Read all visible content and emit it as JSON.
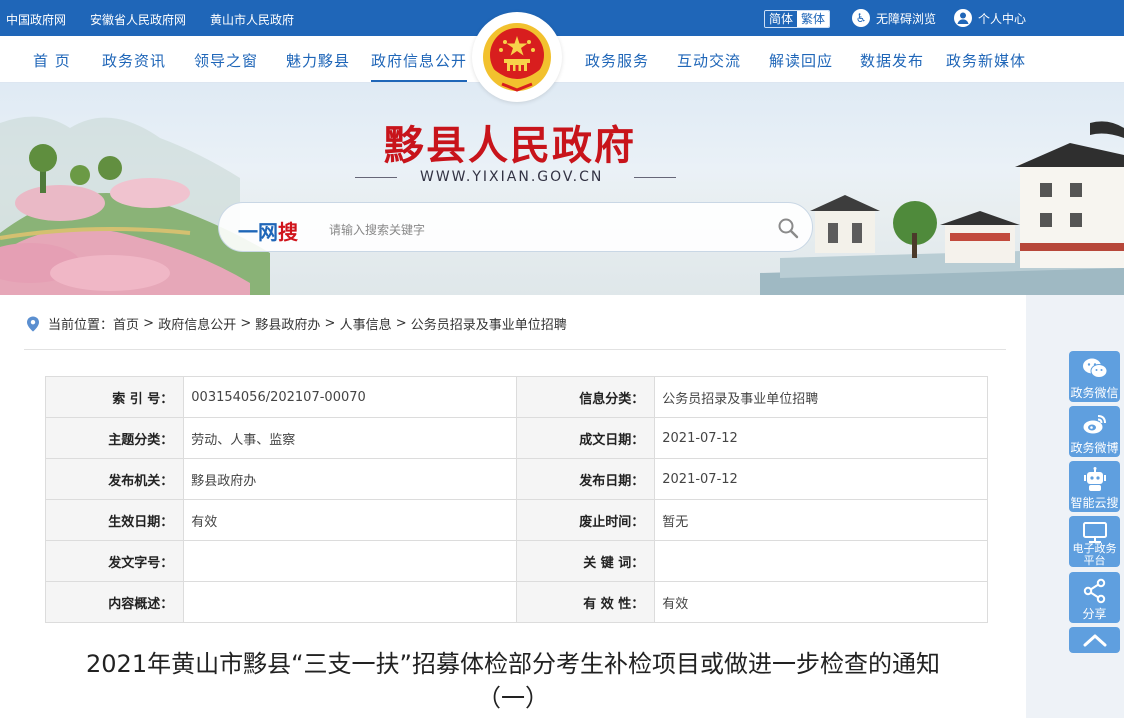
{
  "topbar": {
    "links": [
      "中国政府网",
      "安徽省人民政府网",
      "黄山市人民政府"
    ],
    "lang_simplified": "简体",
    "lang_traditional": "繁体",
    "accessibility": "无障碍浏览",
    "personal_center": "个人中心"
  },
  "nav": {
    "items": [
      "首 页",
      "政务资讯",
      "领导之窗",
      "魅力黟县",
      "政府信息公开",
      "政务服务",
      "互动交流",
      "解读回应",
      "数据发布",
      "政务新媒体"
    ],
    "active": "政府信息公开"
  },
  "banner": {
    "site_title": "黟县人民政府",
    "site_url": "WWW.YIXIAN.GOV.CN"
  },
  "search": {
    "brand_prefix": "一网",
    "brand_highlight": "搜",
    "placeholder": "请输入搜索关键字"
  },
  "breadcrumb": {
    "prefix": "当前位置：",
    "items": [
      "首页",
      "政府信息公开",
      "黟县政府办",
      "人事信息",
      "公务员招录及事业单位招聘"
    ],
    "separator": " > "
  },
  "meta": {
    "rows": [
      [
        {
          "k": "索 引 号：",
          "v": "003154056/202107-00070"
        },
        {
          "k": "信息分类：",
          "v": "公务员招录及事业单位招聘"
        }
      ],
      [
        {
          "k": "主题分类：",
          "v": "劳动、人事、监察"
        },
        {
          "k": "成文日期：",
          "v": "2021-07-12"
        }
      ],
      [
        {
          "k": "发布机关：",
          "v": "黟县政府办"
        },
        {
          "k": "发布日期：",
          "v": "2021-07-12"
        }
      ],
      [
        {
          "k": "生效日期：",
          "v": "有效"
        },
        {
          "k": "废止时间：",
          "v": "暂无"
        }
      ],
      [
        {
          "k": "发文字号：",
          "v": ""
        },
        {
          "k": "关 键 词：",
          "v": ""
        }
      ],
      [
        {
          "k": "内容概述：",
          "v": ""
        },
        {
          "k": "有 效 性：",
          "v": "有效"
        }
      ]
    ]
  },
  "document": {
    "title_line1": "2021年黄山市黟县“三支一扶”招募体检部分考生补检项目或做进一步检查的通知",
    "title_line2": "（一）"
  },
  "sidebar": {
    "items": [
      {
        "label": "政务微信",
        "icon": "wechat-icon"
      },
      {
        "label": "政务微博",
        "icon": "weibo-icon"
      },
      {
        "label": "智能云搜",
        "icon": "robot-icon"
      },
      {
        "label": "电子政务平台",
        "icon": "monitor-icon"
      },
      {
        "label": "分享",
        "icon": "share-icon"
      }
    ],
    "back_to_top_icon": "chevron-up-icon"
  },
  "colors": {
    "primary": "#1f66b8",
    "title_red": "#c8141b",
    "sidebar_blue": "#5f9fdf"
  }
}
